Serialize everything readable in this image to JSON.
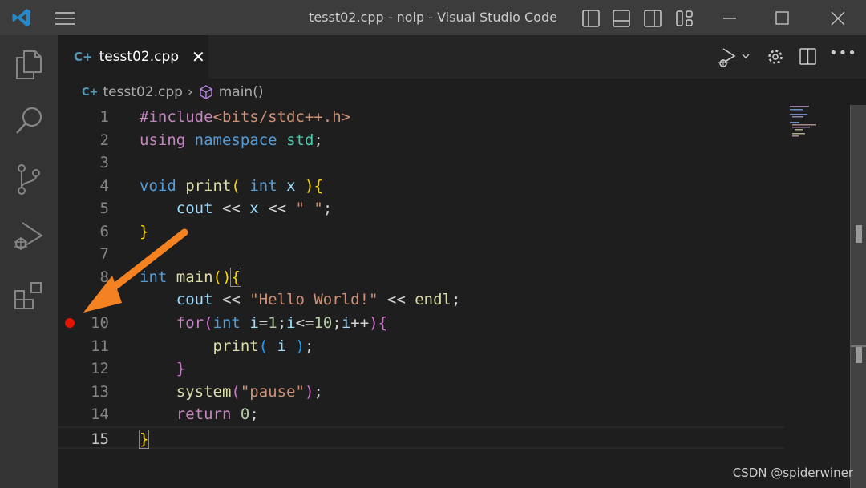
{
  "window": {
    "title": "tesst02.cpp - noip - Visual Studio Code"
  },
  "tab": {
    "label": "tesst02.cpp"
  },
  "breadcrumb": {
    "file": "tesst02.cpp",
    "symbol": "main()"
  },
  "breakpoint_line": 10,
  "watermark": "CSDN @spiderwiner",
  "colors": {
    "breakpoint": "#e51400",
    "arrow": "#f58220",
    "accent": "#3c9be8"
  },
  "code": [
    {
      "n": "1",
      "t": [
        [
          "#include",
          "#c586c0"
        ],
        [
          "<bits/stdc++.h>",
          "#ce9178"
        ]
      ]
    },
    {
      "n": "2",
      "t": [
        [
          "using",
          "#c586c0"
        ],
        [
          " ",
          "#d4d4d4"
        ],
        [
          "namespace",
          "#569cd6"
        ],
        [
          " ",
          "#d4d4d4"
        ],
        [
          "std",
          "#4ec9b0"
        ],
        [
          ";",
          "#d4d4d4"
        ]
      ]
    },
    {
      "n": "3",
      "t": []
    },
    {
      "n": "4",
      "t": [
        [
          "void",
          "#569cd6"
        ],
        [
          " ",
          "#d4d4d4"
        ],
        [
          "print",
          "#dcdcaa"
        ],
        [
          "(",
          "#ffd700"
        ],
        [
          " ",
          "#d4d4d4"
        ],
        [
          "int",
          "#569cd6"
        ],
        [
          " ",
          "#d4d4d4"
        ],
        [
          "x",
          "#9cdcfe"
        ],
        [
          " ",
          "#d4d4d4"
        ],
        [
          ")",
          "#ffd700"
        ],
        [
          "{",
          "#ffd700"
        ]
      ]
    },
    {
      "n": "5",
      "t": [
        [
          "    ",
          "#d4d4d4"
        ],
        [
          "cout",
          "#9cdcfe"
        ],
        [
          " << ",
          "#d4d4d4"
        ],
        [
          "x",
          "#9cdcfe"
        ],
        [
          " << ",
          "#d4d4d4"
        ],
        [
          "\" \"",
          "#ce9178"
        ],
        [
          ";",
          "#d4d4d4"
        ]
      ]
    },
    {
      "n": "6",
      "t": [
        [
          "}",
          "#ffd700"
        ]
      ]
    },
    {
      "n": "7",
      "t": []
    },
    {
      "n": "8",
      "t": [
        [
          "int",
          "#569cd6"
        ],
        [
          " ",
          "#d4d4d4"
        ],
        [
          "main",
          "#dcdcaa"
        ],
        [
          "()",
          "#ffd700"
        ],
        [
          "{",
          "#ffd700",
          "bm"
        ]
      ]
    },
    {
      "n": "9",
      "t": [
        [
          "    ",
          "#d4d4d4"
        ],
        [
          "cout",
          "#9cdcfe"
        ],
        [
          " << ",
          "#d4d4d4"
        ],
        [
          "\"Hello World!\"",
          "#ce9178"
        ],
        [
          " << ",
          "#d4d4d4"
        ],
        [
          "endl",
          "#dcdcaa"
        ],
        [
          ";",
          "#d4d4d4"
        ]
      ]
    },
    {
      "n": "10",
      "t": [
        [
          "    ",
          "#d4d4d4"
        ],
        [
          "for",
          "#c586c0"
        ],
        [
          "(",
          "#da70d6"
        ],
        [
          "int",
          "#569cd6"
        ],
        [
          " ",
          "#d4d4d4"
        ],
        [
          "i",
          "#9cdcfe"
        ],
        [
          "=",
          "#d4d4d4"
        ],
        [
          "1",
          "#b5cea8"
        ],
        [
          ";",
          "#d4d4d4"
        ],
        [
          "i",
          "#9cdcfe"
        ],
        [
          "<=",
          "#d4d4d4"
        ],
        [
          "10",
          "#b5cea8"
        ],
        [
          ";",
          "#d4d4d4"
        ],
        [
          "i",
          "#9cdcfe"
        ],
        [
          "++",
          "#d4d4d4"
        ],
        [
          ")",
          "#da70d6"
        ],
        [
          "{",
          "#da70d6"
        ]
      ]
    },
    {
      "n": "11",
      "t": [
        [
          "        ",
          "#d4d4d4"
        ],
        [
          "print",
          "#dcdcaa"
        ],
        [
          "(",
          "#179fff"
        ],
        [
          " ",
          "#d4d4d4"
        ],
        [
          "i",
          "#9cdcfe"
        ],
        [
          " ",
          "#d4d4d4"
        ],
        [
          ")",
          "#179fff"
        ],
        [
          ";",
          "#d4d4d4"
        ]
      ]
    },
    {
      "n": "12",
      "t": [
        [
          "    ",
          "#d4d4d4"
        ],
        [
          "}",
          "#da70d6"
        ]
      ]
    },
    {
      "n": "13",
      "t": [
        [
          "    ",
          "#d4d4d4"
        ],
        [
          "system",
          "#dcdcaa"
        ],
        [
          "(",
          "#da70d6"
        ],
        [
          "\"pause\"",
          "#ce9178"
        ],
        [
          ")",
          "#da70d6"
        ],
        [
          ";",
          "#d4d4d4"
        ]
      ]
    },
    {
      "n": "14",
      "t": [
        [
          "    ",
          "#d4d4d4"
        ],
        [
          "return",
          "#c586c0"
        ],
        [
          " ",
          "#d4d4d4"
        ],
        [
          "0",
          "#b5cea8"
        ],
        [
          ";",
          "#d4d4d4"
        ]
      ]
    },
    {
      "n": "15",
      "t": [
        [
          "}",
          "#ffd700",
          "bm"
        ]
      ]
    }
  ]
}
